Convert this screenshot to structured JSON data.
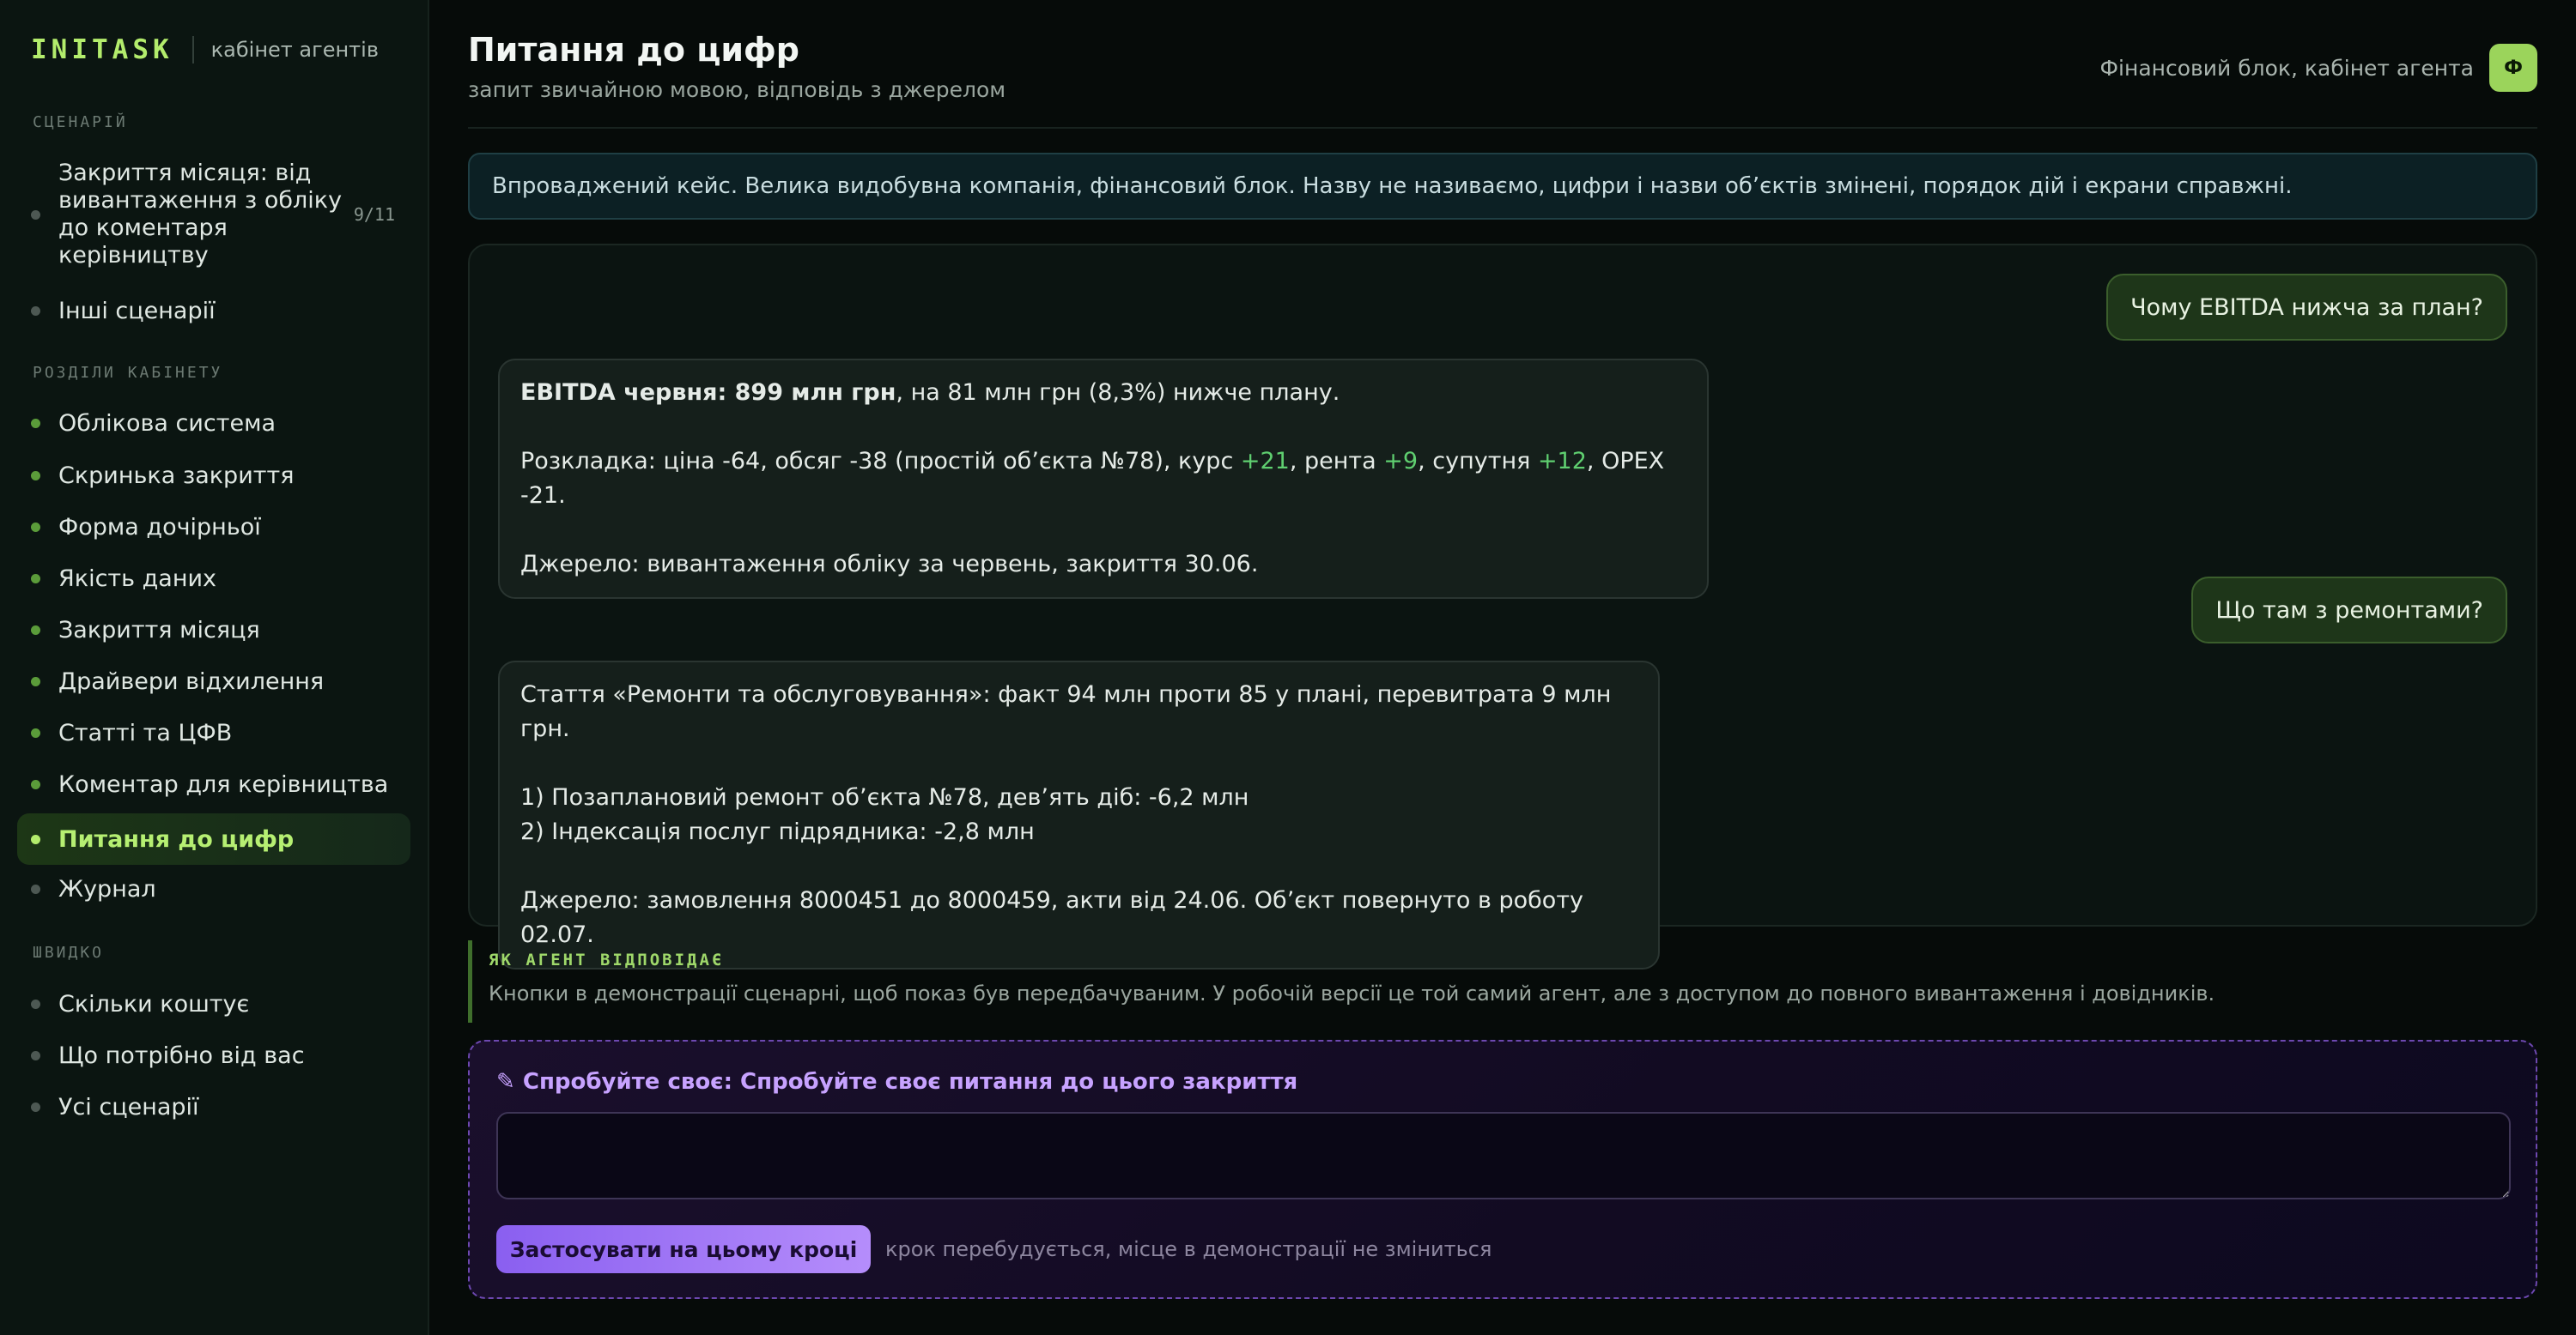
{
  "brand": {
    "logo": "INITASK",
    "subtitle": "кабінет агентів"
  },
  "sidebar": {
    "section_scenario": "СЦЕНАРІЙ",
    "scenario_title": "Закриття місяця: від вивантаження з обліку до коментаря керівництву",
    "scenario_count": "9/11",
    "other_scenarios": "Інші сценарії",
    "section_cabinet": "РОЗДІЛИ КАБІНЕТУ",
    "cabinet_items": [
      "Облікова система",
      "Скринька закриття",
      "Форма дочірньої",
      "Якість даних",
      "Закриття місяця",
      "Драйвери відхилення",
      "Статті та ЦФВ",
      "Коментар для керівництва",
      "Питання до цифр",
      "Журнал"
    ],
    "active_item": "Питання до цифр",
    "section_quick": "ШВИДКО",
    "quick_items": [
      "Скільки коштує",
      "Що потрібно від вас",
      "Усі сценарії"
    ]
  },
  "header": {
    "title": "Питання до цифр",
    "subtitle": "запит звичайною мовою, відповідь з джерелом",
    "context_label": "Фінансовий блок, кабінет агента",
    "avatar_letter": "Ф"
  },
  "notice": "Впроваджений кейс. Велика видобувна компанія, фінансовий блок. Назву не називаємо, цифри і назви об’єктів змінені, порядок дій і екрани справжні.",
  "chat": {
    "q1": "Чому EBITDA нижча за план?",
    "a1": {
      "bold": "EBITDA червня: 899 млн грн",
      "rest": ", на 81 млн грн (8,3%) нижче плану.",
      "breakdown": {
        "prefix": "Розкладка: ціна -64, обсяг -38 (простій об’єкта №78), курс ",
        "kurs": "+21",
        "renta_label": ", рента ",
        "renta": "+9",
        "sup_label": ", супутня ",
        "sup": "+12",
        "opex": ", OPEX -21."
      },
      "source": "Джерело: вивантаження обліку за червень, закриття 30.06."
    },
    "q2": "Що там з ремонтами?",
    "a2": {
      "line1": "Стаття «Ремонти та обслуговування»: факт 94 млн проти 85 у плані, перевитрата 9 млн грн.",
      "item1": "1) Позаплановий ремонт об’єкта №78, дев’ять діб: -6,2 млн",
      "item2": "2) Індексація послуг підрядника: -2,8 млн",
      "source": "Джерело: замовлення 8000451 до 8000459, акти від 24.06. Об’єкт повернуто в роботу 02.07."
    }
  },
  "how": {
    "label": "ЯК АГЕНТ ВІДПОВІДАЄ",
    "text": "Кнопки в демонстрації сценарні, щоб показ був передбачуваним. У робочій версії це той самий агент, але з доступом до повного вивантаження і довідників."
  },
  "try": {
    "icon": "✎",
    "title": "Спробуйте своє: Спробуйте своє питання до цього закриття",
    "input_value": "",
    "button": "Застосувати на цьому кроці",
    "hint": "крок перебудується, місце в демонстрації не зміниться"
  },
  "colors": {
    "accent": "#b3ec6c",
    "positive": "#5fcf70",
    "purple": "#b58dfb"
  }
}
